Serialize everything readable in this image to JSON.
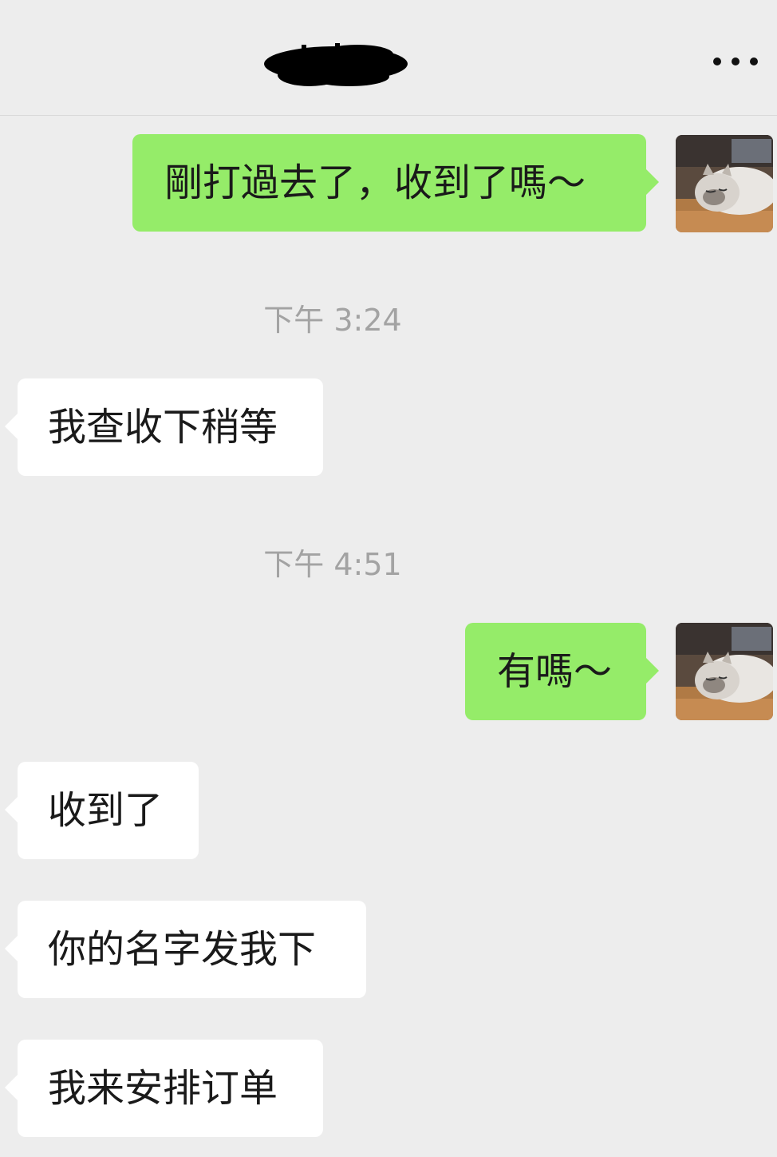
{
  "header": {
    "title_redacted": true,
    "more_icon": "more-dots-icon"
  },
  "messages": [
    {
      "id": "m1",
      "direction": "out",
      "text": "剛打過去了，收到了嗎～",
      "avatar": "cat-avatar"
    },
    {
      "id": "t1",
      "type": "timestamp",
      "text": "下午 3:24"
    },
    {
      "id": "m2",
      "direction": "in",
      "text": "我查收下稍等"
    },
    {
      "id": "t2",
      "type": "timestamp",
      "text": "下午 4:51"
    },
    {
      "id": "m3",
      "direction": "out",
      "text": "有嗎～",
      "avatar": "cat-avatar"
    },
    {
      "id": "m4",
      "direction": "in",
      "text": "收到了"
    },
    {
      "id": "m5",
      "direction": "in",
      "text": "你的名字发我下"
    },
    {
      "id": "m6",
      "direction": "in",
      "text": "我来安排订单"
    }
  ],
  "colors": {
    "background": "#ededed",
    "outgoing_bubble": "#95ec69",
    "incoming_bubble": "#ffffff",
    "timestamp_text": "#a3a3a3"
  }
}
